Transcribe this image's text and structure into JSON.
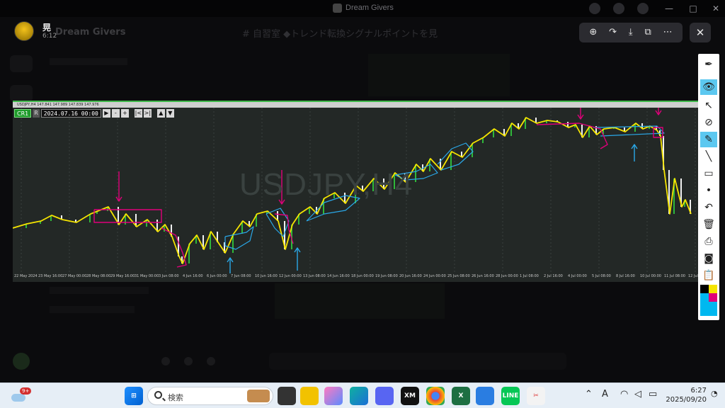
{
  "window": {
    "app_title": "Dream Givers",
    "controls": [
      "—",
      "□",
      "✕"
    ]
  },
  "post": {
    "author": "晃",
    "time": "6:12",
    "server": "Dream Givers",
    "channel_title": "# 自習室 ◆トレンド転換シグナルポイントを見"
  },
  "viewer_toolbar": {
    "icons": [
      "zoom-in-icon",
      "redo-icon",
      "download-icon",
      "open-external-icon",
      "more-icon"
    ],
    "glyphs": [
      "⊕",
      "↷",
      "⤓",
      "⧉",
      "⋯"
    ],
    "close": "✕"
  },
  "chart": {
    "symbol_header": "USDJPY,H4  147.841 147.989 147.839 147.976",
    "watermark": "USDJPY,H4",
    "mode_button": "CR1",
    "r_button": "R",
    "date_field": "2024.07.16 00:00",
    "nav_buttons": [
      "▶",
      "-",
      "+"
    ],
    "scroll_buttons": [
      "|<",
      ">|"
    ],
    "updown_buttons": [
      "▲",
      "▼"
    ],
    "x_ticks": [
      "22 May 2024",
      "23 May 16:00",
      "27 May 00:00",
      "28 May 08:00",
      "29 May 16:00",
      "31 May 00:00",
      "3 Jun 08:00",
      "4 Jun 16:00",
      "6 Jun 00:00",
      "7 Jun 08:00",
      "10 Jun 16:00",
      "12 Jun 00:00",
      "13 Jun 08:00",
      "14 Jun 16:00",
      "18 Jun 00:00",
      "19 Jun 08:00",
      "20 Jun 16:00",
      "24 Jun 00:00",
      "25 Jun 08:00",
      "26 Jun 16:00",
      "28 Jun 00:00",
      "1 Jul 08:00",
      "2 Jul 16:00",
      "4 Jul 00:00",
      "5 Jul 08:00",
      "8 Jul 16:00",
      "10 Jul 00:00",
      "11 Jul 08:00",
      "12 Jul 16:00"
    ]
  },
  "draw_toolbar": {
    "tools": [
      "pen-icon",
      "eye-icon",
      "pointer-icon",
      "lasso-icon",
      "highlighter-icon",
      "line-icon",
      "eraser-icon",
      "dot-icon",
      "undo-icon",
      "trash-icon",
      "stamp-icon",
      "camera-icon",
      "clipboard-icon"
    ],
    "colors": [
      "#000000",
      "#f5e400",
      "#00b8f0",
      "#e0007a",
      "#000000",
      "#00b8f0"
    ]
  },
  "taskbar": {
    "weather_badge": "9+",
    "search_placeholder": "検索",
    "apps": [
      "task-view",
      "file-explorer",
      "copilot",
      "edge",
      "discord",
      "xm",
      "chrome",
      "excel",
      "photos",
      "line",
      "snipping-tool"
    ],
    "time": "6:27",
    "date": "2025/09/20",
    "ime": "A"
  }
}
